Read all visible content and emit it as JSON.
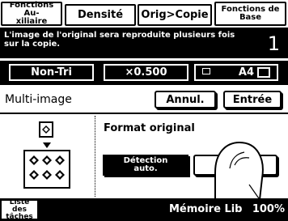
{
  "tabs": [
    {
      "label": "Fonctions Au-\nxiliaire"
    },
    {
      "label": "Densité"
    },
    {
      "label": "Orig>Copie"
    },
    {
      "label": "Fonctions de\nBase"
    }
  ],
  "message": {
    "text": "L'image de l'original sera reproduite plusieurs fois\nsur la copie.",
    "count": "1"
  },
  "controls": {
    "sort": "Non-Tri",
    "zoom": "×0.500",
    "paper": "A4"
  },
  "panel": {
    "title": "Multi-image",
    "cancel": "Annul.",
    "enter": "Entrée",
    "format_label": "Format original",
    "detect_button": "Détection\nauto.",
    "other_button": ""
  },
  "status": {
    "list_button": "Liste des\ntâches",
    "memory": "Mémoire Lib",
    "memory_pct": "100%"
  },
  "colors": {
    "background": "#ffffff",
    "foreground": "#000000"
  }
}
